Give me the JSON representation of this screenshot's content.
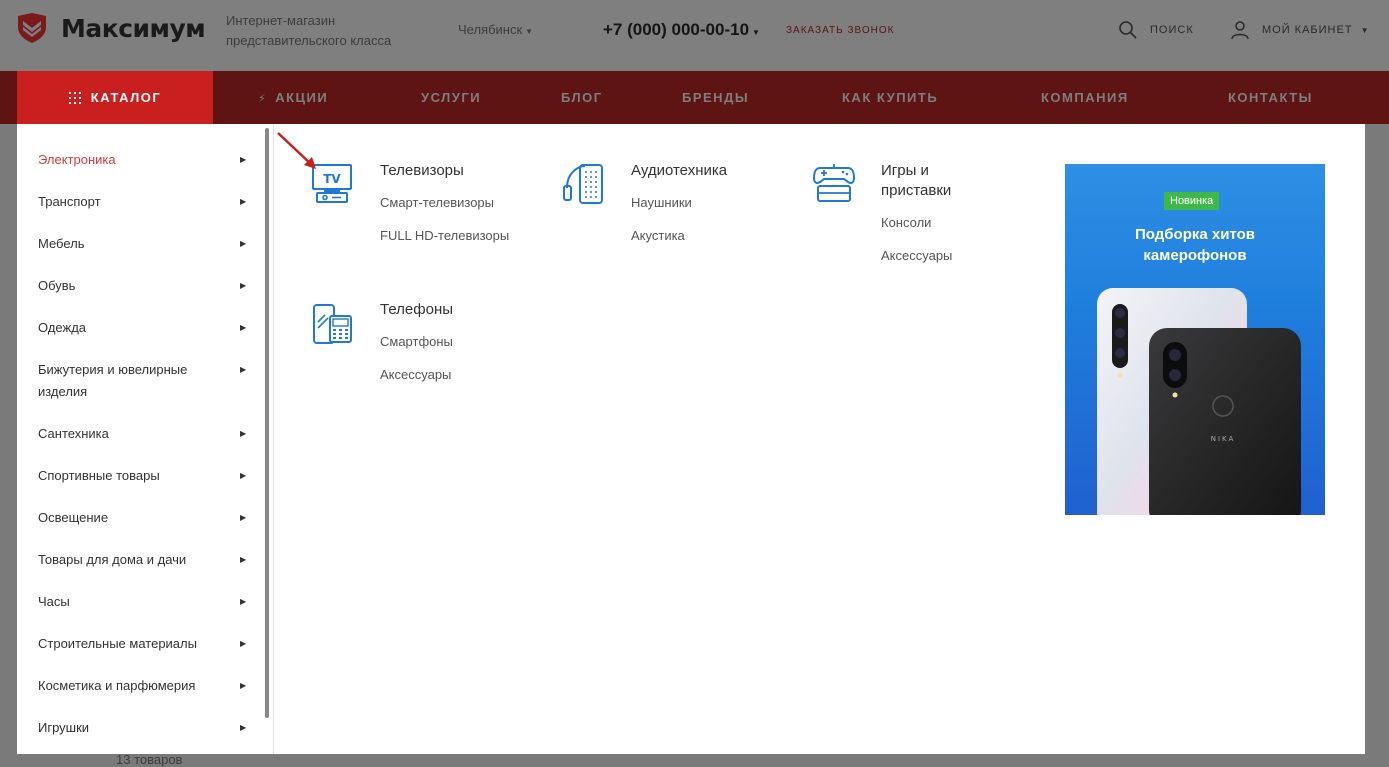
{
  "header": {
    "brand": "Максимум",
    "tagline": "Интернет-магазин представительского класса",
    "city": "Челябинск",
    "phone": "+7 (000) 000-00-10",
    "callback": "ЗАКАЗАТЬ ЗВОНОК",
    "search": "ПОИСК",
    "cabinet": "МОЙ КАБИНЕТ"
  },
  "nav": {
    "catalog": "КАТАЛОГ",
    "items": [
      "АКЦИИ",
      "УСЛУГИ",
      "БЛОГ",
      "БРЕНДЫ",
      "КАК КУПИТЬ",
      "КОМПАНИЯ",
      "КОНТАКТЫ"
    ]
  },
  "menu": {
    "items": [
      "Электроника",
      "Транспорт",
      "Мебель",
      "Обувь",
      "Одежда",
      "Бижутерия и ювелирные изделия",
      "Сантехника",
      "Спортивные товары",
      "Освещение",
      "Товары для дома и дачи",
      "Часы",
      "Строительные материалы",
      "Косметика и парфюмерия",
      "Игрушки"
    ]
  },
  "categories": {
    "tv": {
      "title": "Телевизоры",
      "links": [
        "Смарт-телевизоры",
        "FULL HD-телевизоры"
      ]
    },
    "audio": {
      "title": "Аудиотехника",
      "links": [
        "Наушники",
        "Акустика"
      ]
    },
    "games": {
      "title": "Игры и приставки",
      "links": [
        "Консоли",
        "Аксессуары"
      ]
    },
    "phones": {
      "title": "Телефоны",
      "links": [
        "Смартфоны",
        "Аксессуары"
      ]
    }
  },
  "banner": {
    "badge": "Новинка",
    "title": "Подборка хитов камерофонов",
    "phone_brand": "NIKA"
  },
  "background": {
    "count": "13 товаров"
  },
  "colors": {
    "accent": "#c9201f",
    "link_active": "#d13b3b",
    "icon_blue": "#1e7ad6",
    "badge_green": "#3fb84a"
  }
}
